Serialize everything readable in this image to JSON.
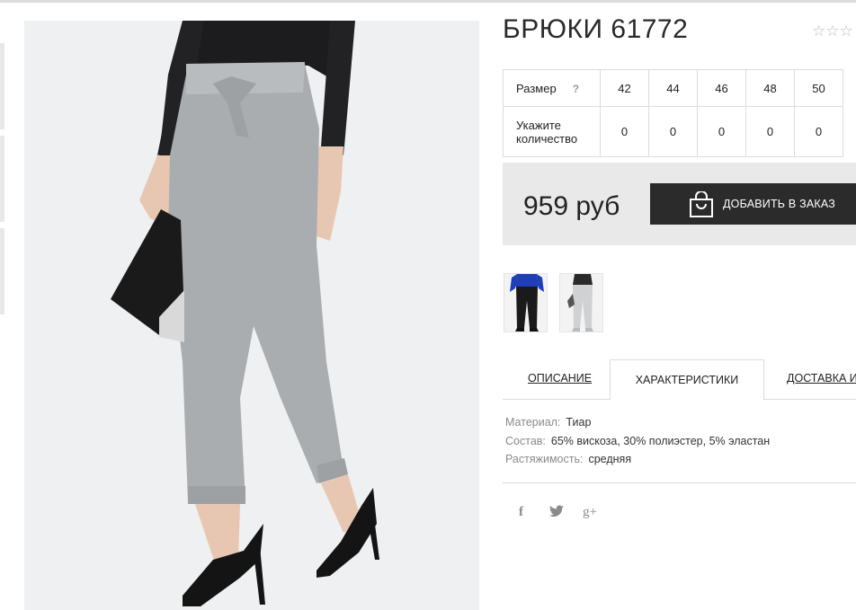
{
  "product": {
    "title": "БРЮКИ 61772",
    "rating_stars": "☆☆☆",
    "price": "959 руб",
    "add_to_order": "ДОБАВИТЬ В ЗАКАЗ"
  },
  "size_table": {
    "size_label": "Размер",
    "help": "?",
    "qty_label": "Укажите количество",
    "sizes": [
      "42",
      "44",
      "46",
      "48",
      "50"
    ],
    "quantities": [
      "0",
      "0",
      "0",
      "0",
      "0"
    ]
  },
  "tabs": {
    "description": "ОПИСАНИЕ",
    "characteristics": "ХАРАКТЕРИСТИКИ",
    "delivery": "ДОСТАВКА И"
  },
  "specs": [
    {
      "key": "Материал:",
      "value": "Тиар"
    },
    {
      "key": "Состав:",
      "value": "65% вискоза, 30% полиэстер, 5% эластан"
    },
    {
      "key": "Растяжимость:",
      "value": "средняя"
    }
  ],
  "social": {
    "facebook": "f",
    "twitter": "🐦",
    "google_plus": "g+"
  },
  "icons": {
    "bag": "shopping-bag-icon",
    "star": "star-outline-icon"
  },
  "colors": {
    "button_bg": "#2b2b2b",
    "price_box_bg": "#e9e9e9",
    "trousers": "#a9adb0"
  }
}
